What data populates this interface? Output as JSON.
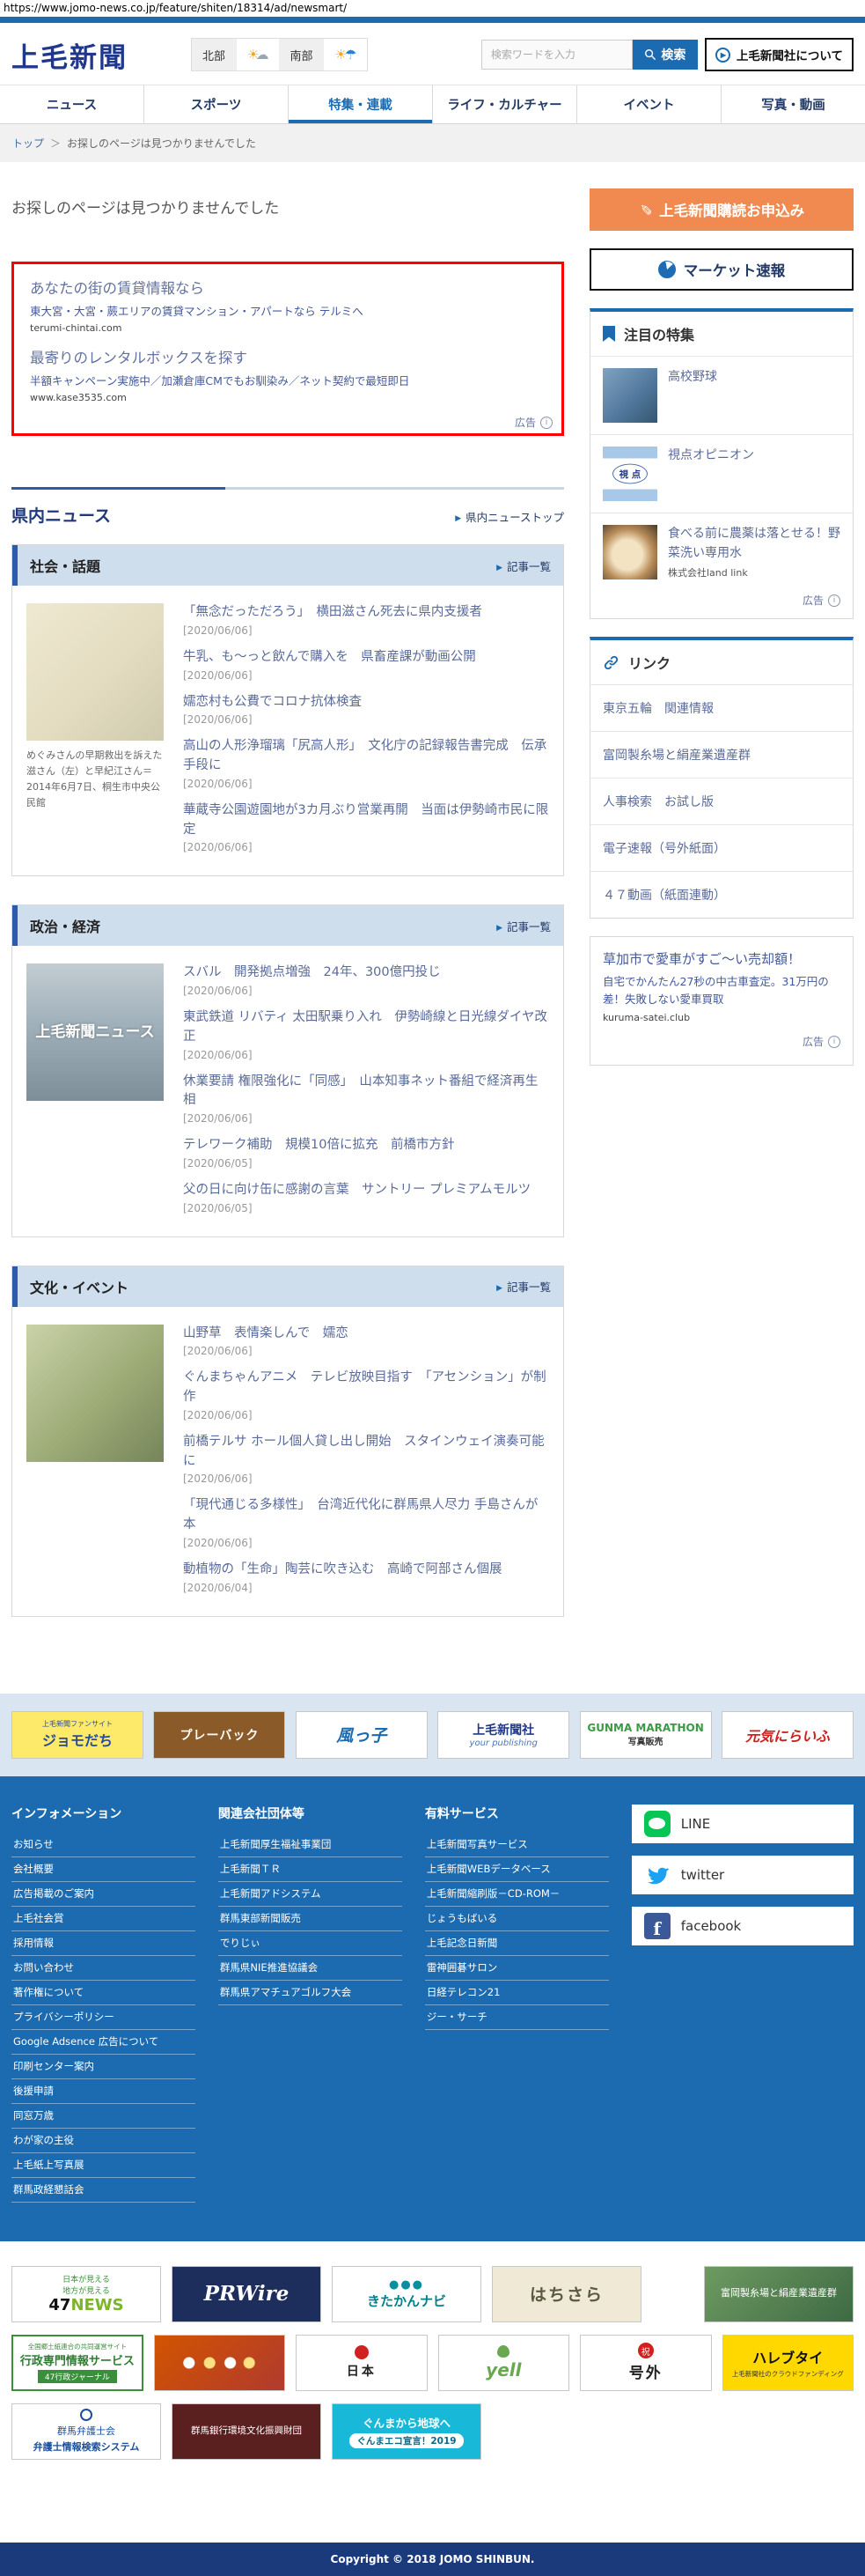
{
  "url": "https://www.jomo-news.co.jp/feature/shiten/18314/ad/newsmart/",
  "header": {
    "logo": "上毛新聞",
    "weather": {
      "north_label": "北部",
      "south_label": "南部"
    },
    "search_placeholder": "検索ワードを入力",
    "search_button": "検索",
    "about_button": "上毛新聞社について"
  },
  "nav": {
    "tabs": [
      "ニュース",
      "スポーツ",
      "特集・連載",
      "ライフ・カルチャー",
      "イベント",
      "写真・動画"
    ]
  },
  "breadcrumb": {
    "home": "トップ",
    "sep": "＞",
    "current": "お探しのページは見つかりませんでした"
  },
  "not_found_title": "お探しのページは見つかりませんでした",
  "main_ad": {
    "items": [
      {
        "title": "あなたの街の賃貸情報なら",
        "desc": "東大宮・大宮・蕨エリアの賃貸マンション・アパートなら テルミへ",
        "url": "terumi-chintai.com"
      },
      {
        "title": "最寄りのレンタルボックスを探す",
        "desc": "半額キャンペーン実施中／加瀬倉庫CMでもお馴染み／ネット契約で最短即日",
        "url": "www.kase3535.com"
      }
    ],
    "ad_label": "広告"
  },
  "sidebar": {
    "subscribe_button": "上毛新聞購読お申込み",
    "market_button": "マーケット速報",
    "featured": {
      "title": "注目の特集",
      "items": [
        {
          "title": "高校野球"
        },
        {
          "title": "視点オピニオン",
          "thumb_text": "視 点"
        },
        {
          "title": "食べる前に農薬は落とせる！野菜洗い専用水",
          "source": "株式会社land link",
          "ad_label": "広告"
        }
      ]
    },
    "links": {
      "title": "リンク",
      "items": [
        "東京五輪　関連情報",
        "富岡製糸場と絹産業遺産群",
        "人事検索　お試し版",
        "電子速報（号外紙面）",
        "４７動画（紙面連動）"
      ]
    },
    "ad": {
      "title": "草加市で愛車がすご〜い売却額！",
      "desc": "自宅でかんたん27秒の中古車査定。31万円の差！失敗しない愛車買取",
      "url": "kuruma-satei.club",
      "ad_label": "広告"
    }
  },
  "news": {
    "title": "県内ニュース",
    "top_link": "県内ニューストップ",
    "list_link": "記事一覧",
    "sections": [
      {
        "name": "社会・話題",
        "caption": "めぐみさんの早期救出を訴えた滋さん（左）と早紀江さん＝2014年6月7日、桐生市中央公民館",
        "articles": [
          {
            "title": "「無念だっただろう」　横田滋さん死去に県内支援者",
            "date": "[2020/06/06]"
          },
          {
            "title": "牛乳、も〜っと飲んで購入を　県畜産課が動画公開",
            "date": "[2020/06/06]"
          },
          {
            "title": "嬬恋村も公費でコロナ抗体検査",
            "date": "[2020/06/06]"
          },
          {
            "title": "高山の人形浄瑠璃「尻高人形」　文化庁の記録報告書完成　伝承手段に",
            "date": "[2020/06/06]"
          },
          {
            "title": "華蔵寺公園遊園地が3カ月ぶり営業再開　当面は伊勢崎市民に限定",
            "date": "[2020/06/06]"
          }
        ]
      },
      {
        "name": "政治・経済",
        "thumb_text": "上毛新聞ニュース",
        "articles": [
          {
            "title": "スバル　開発拠点増強　24年、300億円投じ",
            "date": "[2020/06/06]"
          },
          {
            "title": "東武鉄道 リバティ 太田駅乗り入れ　伊勢崎線と日光線ダイヤ改正",
            "date": "[2020/06/06]"
          },
          {
            "title": "休業要請 権限強化に「同感」　山本知事ネット番組で経済再生相",
            "date": "[2020/06/06]"
          },
          {
            "title": "テレワーク補助　規模10倍に拡充　前橋市方針",
            "date": "[2020/06/05]"
          },
          {
            "title": "父の日に向け缶に感謝の言葉　サントリー プレミアムモルツ",
            "date": "[2020/06/05]"
          }
        ]
      },
      {
        "name": "文化・イベント",
        "articles": [
          {
            "title": "山野草　表情楽しんで　嬬恋",
            "date": "[2020/06/06]"
          },
          {
            "title": "ぐんまちゃんアニメ　テレビ放映目指す　「アセンション」が制作",
            "date": "[2020/06/06]"
          },
          {
            "title": "前橋テルサ ホール個人貸し出し開始　スタインウェイ演奏可能に",
            "date": "[2020/06/06]"
          },
          {
            "title": "「現代通じる多様性」　台湾近代化に群馬県人尽力 手島さんが本",
            "date": "[2020/06/06]"
          },
          {
            "title": "動植物の「生命」陶芸に吹き込む　高崎で阿部さん個展",
            "date": "[2020/06/04]"
          }
        ]
      }
    ]
  },
  "partners": {
    "items": [
      {
        "label": "ジョモだち",
        "sub": "上毛新聞ファンサイト"
      },
      {
        "label": "プレーバック",
        "sub": ""
      },
      {
        "label": "風っ子",
        "sub": ""
      },
      {
        "label": "上毛新聞社",
        "sub": "your publishing"
      },
      {
        "label": "GUNMA MARATHON",
        "sub": "写真販売"
      },
      {
        "label": "元気にらいふ",
        "sub": ""
      }
    ]
  },
  "footer": {
    "columns": [
      {
        "title": "インフォメーション",
        "items": [
          "お知らせ",
          "会社概要",
          "広告掲載のご案内",
          "上毛社会賞",
          "採用情報",
          "お問い合わせ",
          "著作権について",
          "プライバシーポリシー",
          "Google Adsence 広告について",
          "印刷センター案内",
          "後援申請",
          "同窓万歳",
          "わが家の主役",
          "上毛紙上写真展",
          "群馬政経懇話会"
        ]
      },
      {
        "title": "関連会社団体等",
        "items": [
          "上毛新聞厚生福祉事業団",
          "上毛新聞ＴＲ",
          "上毛新聞アドシステム",
          "群馬東部新聞販売",
          "でりじぃ",
          "群馬県NIE推進協議会",
          "群馬県アマチュアゴルフ大会"
        ]
      },
      {
        "title": "有料サービス",
        "items": [
          "上毛新聞写真サービス",
          "上毛新聞WEBデータベース",
          "上毛新聞縮刷版－CD-ROM－",
          "じょうもばいる",
          "上毛記念日新聞",
          "雷神囲碁サロン",
          "日経テレコン21",
          "ジー・サーチ"
        ]
      }
    ],
    "social": [
      {
        "label": "LINE"
      },
      {
        "label": "twitter"
      },
      {
        "label": "facebook"
      }
    ]
  },
  "banners": {
    "b47": {
      "l1": "日本が見える",
      "l2": "地方が見える",
      "l3": "47",
      "l3b": "NEWS"
    },
    "pr": {
      "l1": "PRWire"
    },
    "kita": {
      "l1": "きたかんナビ"
    },
    "hachi": {
      "l1": "はちさら"
    },
    "silk": {
      "l1": "富岡製糸場と絹産業遺産群"
    },
    "gyosei": {
      "l1": "全国郷土紙連合の共同運営サイト",
      "l2": "行政専門情報サービス",
      "l3": "47行政ジャーナル"
    },
    "nihon": {
      "l1": "日本"
    },
    "yell": {
      "l1": "yell"
    },
    "gogai": {
      "l1": "号外"
    },
    "hare": {
      "l1": "ハレブタイ",
      "l2": "上毛新聞社のクラウドファンディング"
    },
    "bengo": {
      "l1": "群馬弁護士会",
      "l2": "弁護士情報検索システム"
    },
    "gunbank": {
      "l1": "群馬銀行環境文化振興財団"
    },
    "eco": {
      "l1": "ぐんまから地球へ",
      "l2": "ぐんまエコ宣言！2019"
    }
  },
  "copyright": "Copyright © 2018 JOMO SHINBUN."
}
